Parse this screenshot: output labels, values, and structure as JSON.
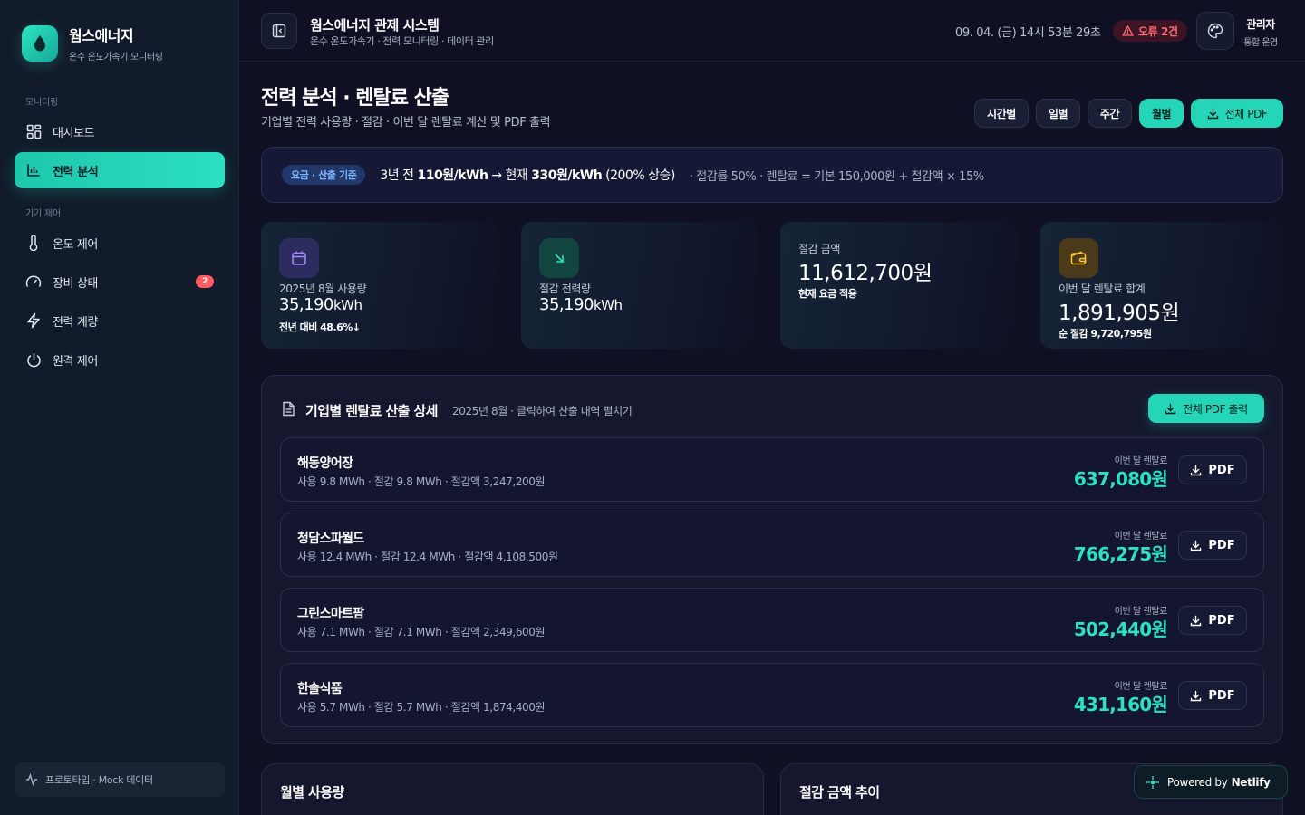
{
  "brand": {
    "title": "웜스에너지",
    "subtitle": "온수 온도가속기 모니터링"
  },
  "sidebar": {
    "section_monitoring": "모니터링",
    "section_device": "기기 제어",
    "items": [
      {
        "label": "대시보드",
        "icon": "grid-icon"
      },
      {
        "label": "전력 분석",
        "icon": "bar-chart-icon",
        "active": true
      },
      {
        "label": "온도 제어",
        "icon": "thermometer-icon"
      },
      {
        "label": "장비 상태",
        "icon": "gauge-icon",
        "badge": "2"
      },
      {
        "label": "전력 계량",
        "icon": "bolt-icon"
      },
      {
        "label": "원격 제어",
        "icon": "power-icon"
      }
    ],
    "footer": "프로토타입 · Mock 데이터"
  },
  "header": {
    "title": "웜스에너지 관제 시스템",
    "subtitle": "온수 온도가속기 · 전력 모니터링 · 데이터 관리",
    "datetime": "09. 04. (금) 14시 53분 29초",
    "error_badge": "오류 2건",
    "user_name": "관리자",
    "user_role": "통합 운영"
  },
  "page": {
    "title": "전력 분석 · 렌탈료 산출",
    "subtitle": "기업별 전력 사용량 · 절감 · 이번 달 렌탈료 계산 및 PDF 출력",
    "period_tabs": [
      "시간별",
      "일별",
      "주간",
      "월별"
    ],
    "active_period": "월별",
    "pdf_all": "전체 PDF"
  },
  "banner": {
    "tag": "요금 · 산출 기준",
    "main_prefix": "3년 전 ",
    "old_rate": "110원/kWh",
    "arrow": " → 현재 ",
    "new_rate": "330원/kWh",
    "increase": " (200% 상승)",
    "note": "· 절감률 50% · 렌탈료 = 기본 150,000원 + 절감액 × 15%"
  },
  "stats": [
    {
      "label": "2025년 8월 사용량",
      "value": "35,190",
      "unit": "kWh",
      "note": "전년 대비 48.6%↓",
      "icon": "calendar-icon"
    },
    {
      "label": "절감 전력량",
      "value": "35,190",
      "unit": "kWh",
      "note": "",
      "icon": "arrow-down-right-icon"
    },
    {
      "label": "절감 금액",
      "value": "11,612,700원",
      "unit": "",
      "note": "현재 요금 적용",
      "icon": ""
    },
    {
      "label": "이번 달 렌탈료 합계",
      "value": "1,891,905원",
      "unit": "",
      "note": "순 절감 9,720,795원",
      "icon": "wallet-icon"
    }
  ],
  "rental_panel": {
    "title": "기업별 렌탈료 산출 상세",
    "subtitle": "2025년 8월 · 클릭하여 산출 내역 펼치기",
    "pdf_button": "전체 PDF 출력",
    "amount_caption": "이번 달 렌탈료",
    "row_pdf": "PDF",
    "companies": [
      {
        "name": "해동양어장",
        "detail": "사용 9.8 MWh · 절감 9.8 MWh · 절감액 3,247,200원",
        "amount": "637,080원"
      },
      {
        "name": "청담스파월드",
        "detail": "사용 12.4 MWh · 절감 12.4 MWh · 절감액 4,108,500원",
        "amount": "766,275원"
      },
      {
        "name": "그린스마트팜",
        "detail": "사용 7.1 MWh · 절감 7.1 MWh · 절감액 2,349,600원",
        "amount": "502,440원"
      },
      {
        "name": "한솔식품",
        "detail": "사용 5.7 MWh · 절감 5.7 MWh · 절감액 1,874,400원",
        "amount": "431,160원"
      }
    ]
  },
  "bottom_cards": {
    "monthly_usage": "월별 사용량",
    "savings_trend": "절감 금액 추이"
  },
  "netlify": {
    "prefix": "Powered by",
    "brand": "Netlify"
  },
  "colors": {
    "accent": "#25d5b7",
    "error": "#ff5a5f",
    "bg": "#0f1024",
    "sidebar": "#121b2b"
  }
}
